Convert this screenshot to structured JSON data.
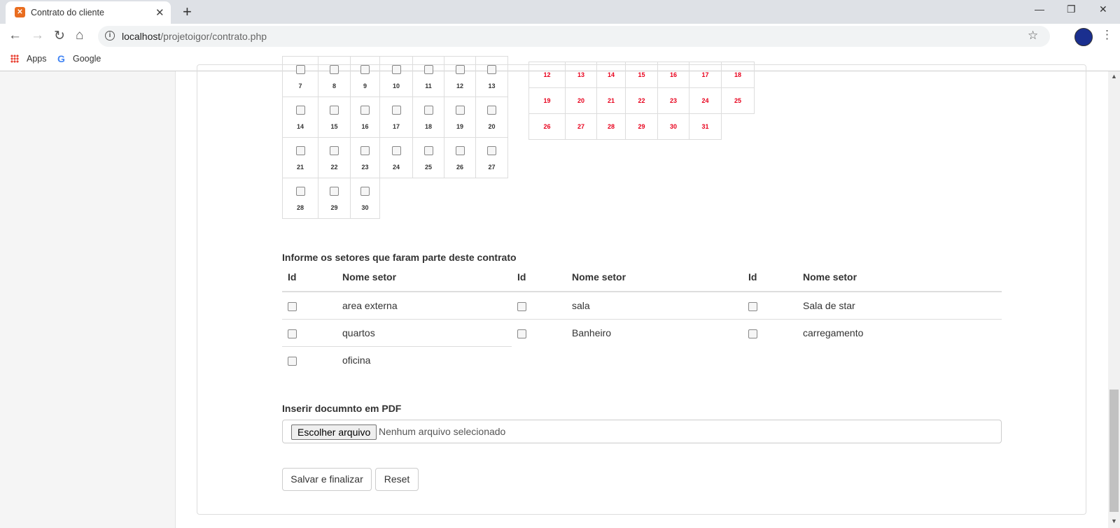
{
  "browser": {
    "tab_title": "Contrato do cliente",
    "tab_close": "✕",
    "new_tab": "+",
    "url_host": "localhost",
    "url_path": "/projetoigor/contrato.php",
    "bookmarks": {
      "apps": "Apps",
      "google": "Google"
    },
    "window_controls": {
      "minimize": "—",
      "restore": "❐",
      "close": "✕"
    },
    "nav": {
      "back": "←",
      "forward": "→",
      "reload": "↻",
      "home": "⌂"
    }
  },
  "calendar_left": {
    "rows": [
      [
        "7",
        "8",
        "9",
        "10",
        "11",
        "12",
        "13"
      ],
      [
        "14",
        "15",
        "16",
        "17",
        "18",
        "19",
        "20"
      ],
      [
        "21",
        "22",
        "23",
        "24",
        "25",
        "26",
        "27"
      ],
      [
        "28",
        "29",
        "30"
      ]
    ]
  },
  "calendar_right": {
    "rows": [
      [
        "12",
        "13",
        "14",
        "15",
        "16",
        "17",
        "18"
      ],
      [
        "19",
        "20",
        "21",
        "22",
        "23",
        "24",
        "25"
      ],
      [
        "26",
        "27",
        "28",
        "29",
        "30",
        "31"
      ]
    ],
    "day_color": "#e8001c"
  },
  "sectors": {
    "title": "Informe os setores que faram parte deste contrato",
    "headers": [
      "Id",
      "Nome setor",
      "Id",
      "Nome setor",
      "Id",
      "Nome setor"
    ],
    "columns": [
      [
        "area externa",
        "quartos",
        "oficina"
      ],
      [
        "sala",
        "Banheiro"
      ],
      [
        "Sala de star",
        "carregamento"
      ]
    ]
  },
  "pdf": {
    "label": "Inserir documnto em PDF",
    "button": "Escolher arquivo",
    "status": "Nenhum arquivo selecionado"
  },
  "actions": {
    "save": "Salvar e finalizar",
    "reset": "Reset"
  }
}
